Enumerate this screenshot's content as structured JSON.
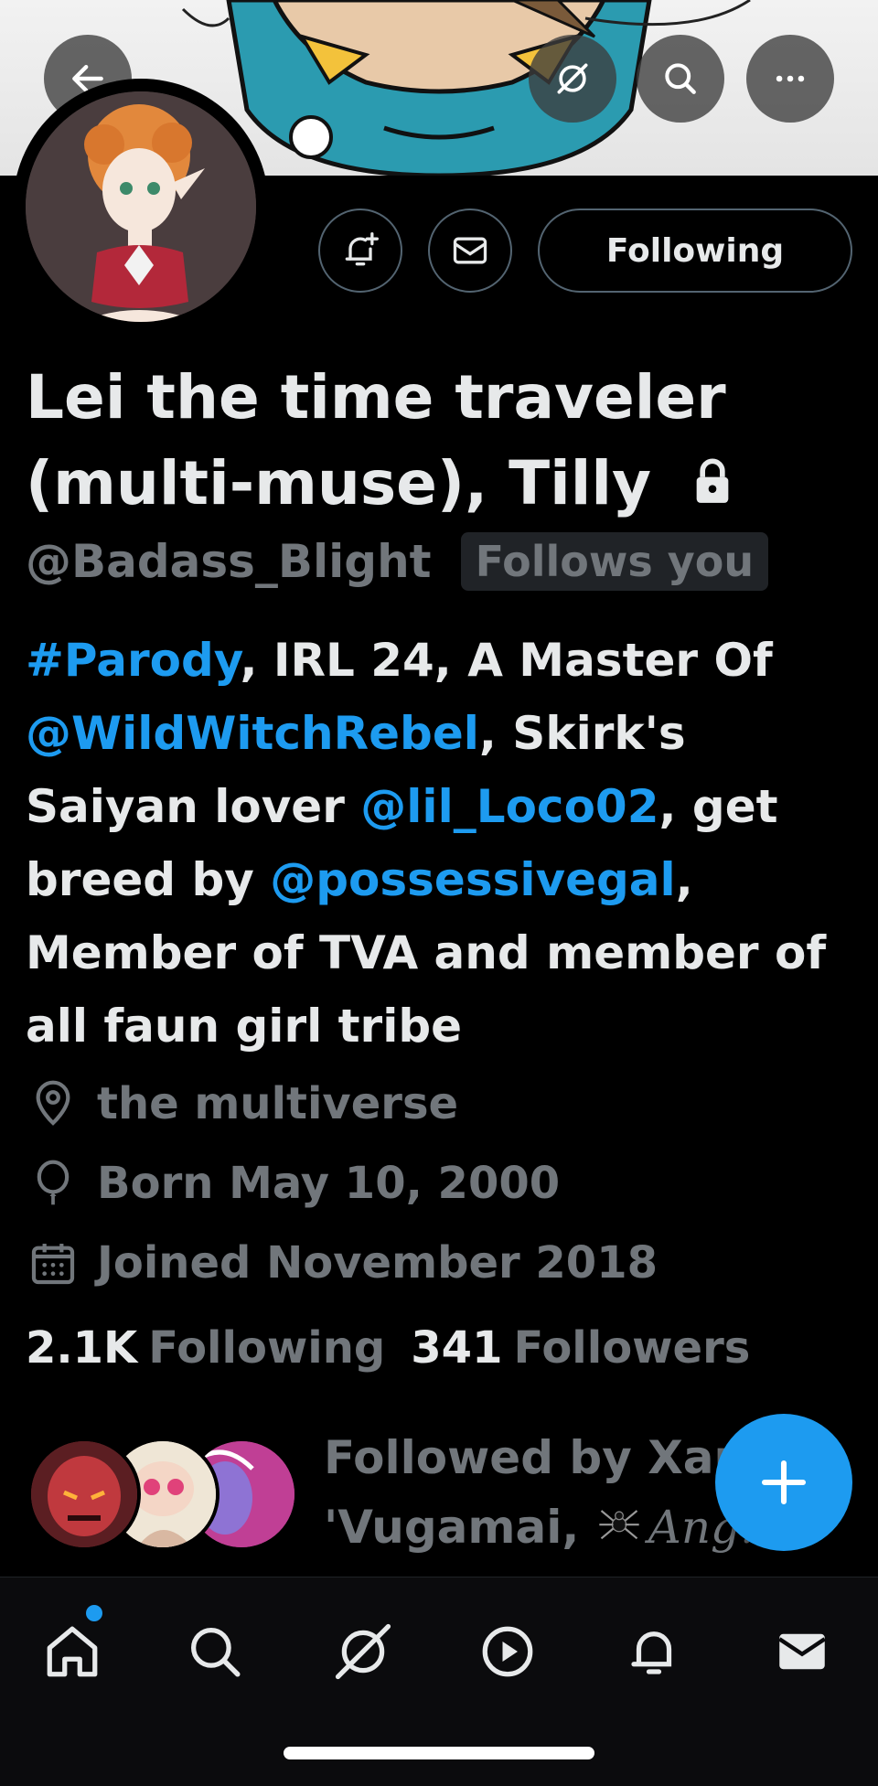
{
  "header": {
    "back_icon": "arrow-left-icon",
    "grok_icon": "grok-icon",
    "search_icon": "search-icon",
    "more_icon": "more-horizontal-icon"
  },
  "actions": {
    "notify_icon": "bell-plus-icon",
    "message_icon": "envelope-icon",
    "following_label": "Following"
  },
  "profile": {
    "name": "Lei the time traveler (multi-muse), Tilly",
    "protected_icon": "lock-icon",
    "handle": "@Badass_Blight",
    "follows_you": "Follows you"
  },
  "bio": {
    "hashtag": "#Parody",
    "text1": ", IRL 24, A Master Of ",
    "mention1": "@WildWitchRebel",
    "text2": ", Skirk's Saiyan lover ",
    "mention2": "@lil_Loco02",
    "text3": ", get breed by ",
    "mention3": "@possessivegal",
    "text4": ", Member of TVA and member of all faun girl tribe"
  },
  "meta": {
    "location": "the multiverse",
    "birthday": "Born May 10, 2000",
    "joined": "Joined November 2018"
  },
  "counts": {
    "following_count": "2.1K",
    "following_label": "Following",
    "followers_count": "341",
    "followers_label": "Followers"
  },
  "followed_by": {
    "line1": "Followed by Xam",
    "line2_a": "'Vugamai, ",
    "line2_b": "Ang..."
  },
  "fab": {
    "icon": "plus-icon"
  },
  "nav": {
    "items": [
      "home-icon",
      "search-icon",
      "grok-icon",
      "play-icon",
      "bell-icon",
      "mail-icon"
    ],
    "active": "home-icon"
  },
  "colors": {
    "accent": "#1d9bf0",
    "background": "#000000",
    "text_primary": "#e7e9ea",
    "text_secondary": "#71767b"
  }
}
